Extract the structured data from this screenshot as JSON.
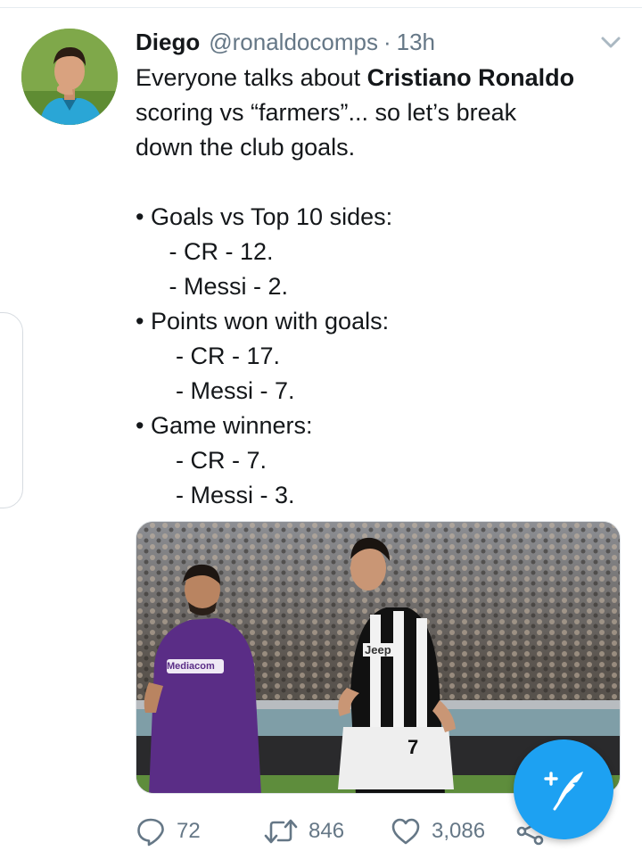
{
  "tweet": {
    "author": {
      "display_name": "Diego",
      "handle": "@ronaldocomps",
      "separator": "·",
      "time": "13h"
    },
    "text_lines": [
      {
        "parts": [
          {
            "text": "Everyone talks about ",
            "bold": false
          },
          {
            "text": "Cristiano Ronaldo",
            "bold": true
          }
        ]
      },
      {
        "parts": [
          {
            "text": "scoring vs “farmers”... so let’s break",
            "bold": false
          }
        ]
      },
      {
        "parts": [
          {
            "text": "down the club goals.",
            "bold": false
          }
        ]
      },
      {
        "parts": [
          {
            "text": "",
            "bold": false
          }
        ]
      },
      {
        "parts": [
          {
            "text": "• Goals vs Top 10 sides:",
            "bold": false
          }
        ]
      },
      {
        "parts": [
          {
            "text": "     - CR - 12.",
            "bold": false
          }
        ]
      },
      {
        "parts": [
          {
            "text": "     - Messi - 2.",
            "bold": false
          }
        ]
      },
      {
        "parts": [
          {
            "text": "• Points won with goals:",
            "bold": false
          }
        ]
      },
      {
        "parts": [
          {
            "text": "      - CR - 17.",
            "bold": false
          }
        ]
      },
      {
        "parts": [
          {
            "text": "      - Messi - 7.",
            "bold": false
          }
        ]
      },
      {
        "parts": [
          {
            "text": "• Game winners:",
            "bold": false
          }
        ]
      },
      {
        "parts": [
          {
            "text": "      - CR - 7.",
            "bold": false
          }
        ]
      },
      {
        "parts": [
          {
            "text": "      - Messi - 3.",
            "bold": false
          }
        ]
      }
    ],
    "media": {
      "jersey_number": "7",
      "sponsor_text": "Mediacom",
      "jeep_text": "Jeep"
    },
    "actions": {
      "reply": {
        "icon": "reply-icon",
        "count": "72"
      },
      "retweet": {
        "icon": "retweet-icon",
        "count": "846"
      },
      "like": {
        "icon": "heart-icon",
        "count": "3,086"
      },
      "share": {
        "icon": "share-icon"
      }
    }
  },
  "compose_button": {
    "icon": "compose-feather-icon"
  },
  "colors": {
    "accent": "#1da1f2",
    "text_primary": "#14171a",
    "text_secondary": "#657786",
    "divider": "#e6ecf0"
  }
}
